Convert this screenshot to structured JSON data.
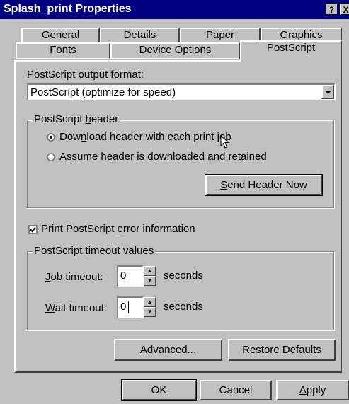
{
  "window": {
    "title": "Splash_print Properties",
    "help_glyph": "?",
    "close_glyph": "X"
  },
  "tabs_back": [
    "General",
    "Details",
    "Paper",
    "Graphics"
  ],
  "tabs_front": [
    "Fonts",
    "Device Options",
    "PostScript"
  ],
  "active_tab": "PostScript",
  "output_format": {
    "label_pre": "PostScript ",
    "label_u": "o",
    "label_post": "utput format:",
    "value": "PostScript (optimize for speed)"
  },
  "header_group": {
    "label_pre": "PostScript ",
    "label_u": "h",
    "label_post": "eader",
    "option1": {
      "pre": "Dow",
      "u": "n",
      "post": "load header with each print job",
      "selected": true
    },
    "option2": {
      "pre": "Assume header is downloaded and ",
      "u": "r",
      "post": "etained",
      "selected": false
    },
    "send_button": {
      "u": "S",
      "post": "end Header Now"
    }
  },
  "error_info": {
    "pre": "Print PostScript ",
    "u": "e",
    "post": "rror information",
    "checked": true
  },
  "timeout_group": {
    "label_pre": "PostScript ",
    "label_u": "t",
    "label_post": "imeout values",
    "job": {
      "u": "J",
      "post": "ob timeout:",
      "value": "0",
      "unit": "seconds"
    },
    "wait": {
      "u": "W",
      "post": "ait timeout:",
      "value": "0",
      "unit": "seconds"
    }
  },
  "buttons": {
    "advanced": {
      "pre": "Ad",
      "u": "v",
      "post": "anced..."
    },
    "restore": {
      "pre": "Restore ",
      "u": "D",
      "post": "efaults"
    },
    "ok": "OK",
    "cancel": "Cancel",
    "apply": {
      "u": "A",
      "post": "pply"
    }
  }
}
